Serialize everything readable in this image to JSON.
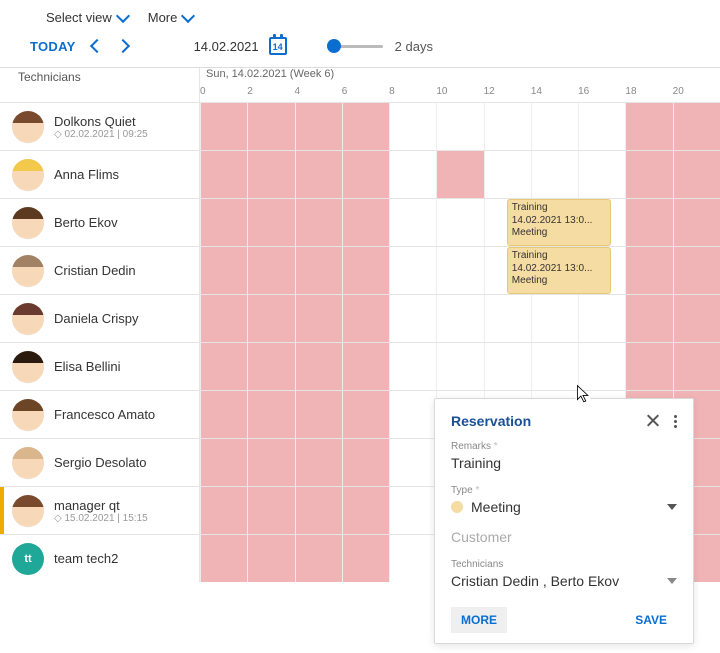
{
  "topbar": {
    "select_view": "Select view",
    "more": "More"
  },
  "toolbar": {
    "today": "TODAY",
    "date": "14.02.2021",
    "calendar_day": "14",
    "range_label": "2 days"
  },
  "header": {
    "technicians_label": "Technicians",
    "day_label": "Sun, 14.02.2021 (Week 6)",
    "hours": [
      "0",
      "2",
      "4",
      "6",
      "8",
      "10",
      "12",
      "14",
      "16",
      "18",
      "20"
    ]
  },
  "technicians": [
    {
      "name": "Dolkons Quiet",
      "sub": "◇ 02.02.2021 | 09:25",
      "hair": "#7a4a2e",
      "orange": false
    },
    {
      "name": "Anna Flims",
      "sub": "",
      "hair": "#f3c94b",
      "orange": false
    },
    {
      "name": "Berto Ekov",
      "sub": "",
      "hair": "#5b3a1f",
      "orange": false
    },
    {
      "name": "Cristian Dedin",
      "sub": "",
      "hair": "#a28265",
      "orange": false
    },
    {
      "name": "Daniela Crispy",
      "sub": "",
      "hair": "#6a3a2e",
      "orange": false
    },
    {
      "name": "Elisa Bellini",
      "sub": "",
      "hair": "#2b1a0e",
      "orange": false
    },
    {
      "name": "Francesco Amato",
      "sub": "",
      "hair": "#6b4525",
      "orange": false
    },
    {
      "name": "Sergio Desolato",
      "sub": "",
      "hair": "#d9b68c",
      "orange": false
    },
    {
      "name": "manager qt",
      "sub": "◇ 15.02.2021 | 15:15",
      "hair": "#7a4a2e",
      "orange": true
    },
    {
      "name": "team tech2",
      "sub": "",
      "hair": "",
      "orange": false,
      "team_initials": "tt",
      "team_color": "#1fa898"
    }
  ],
  "events": {
    "title": "Training",
    "time": "14.02.2021 13:0...",
    "type": "Meeting"
  },
  "popover": {
    "title": "Reservation",
    "remarks_label": "Remarks",
    "remarks_value": "Training",
    "type_label": "Type",
    "type_value": "Meeting",
    "customer_label": "Customer",
    "technicians_label": "Technicians",
    "technicians_value": "Cristian Dedin , Berto Ekov",
    "more": "MORE",
    "save": "SAVE"
  }
}
